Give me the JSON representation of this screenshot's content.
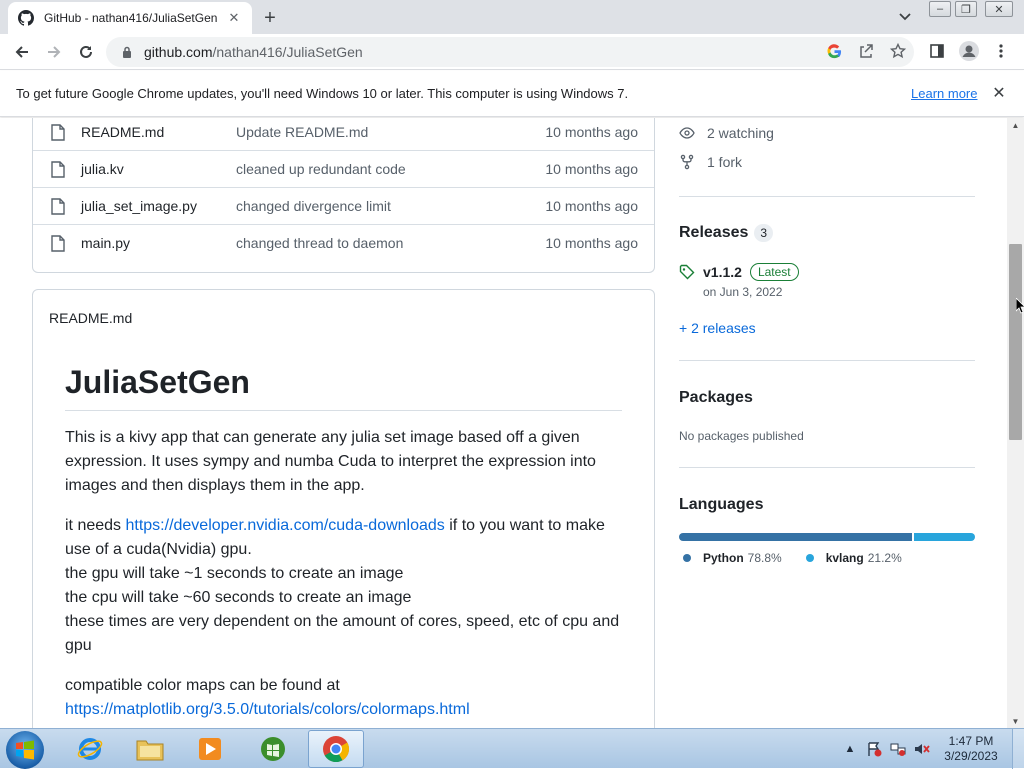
{
  "browser": {
    "tab_title": "GitHub - nathan416/JuliaSetGen",
    "url_host": "github.com",
    "url_path": "/nathan416/JuliaSetGen",
    "infobar_message": "To get future Google Chrome updates, you'll need Windows 10 or later. This computer is using Windows 7.",
    "infobar_link": "Learn more"
  },
  "files": [
    {
      "name": "README.md",
      "message": "Update README.md",
      "age": "10 months ago"
    },
    {
      "name": "julia.kv",
      "message": "cleaned up redundant code",
      "age": "10 months ago"
    },
    {
      "name": "julia_set_image.py",
      "message": "changed divergence limit",
      "age": "10 months ago"
    },
    {
      "name": "main.py",
      "message": "changed thread to daemon",
      "age": "10 months ago"
    }
  ],
  "readme": {
    "header": "README.md",
    "title": "JuliaSetGen",
    "para1": "This is a kivy app that can generate any julia set image based off a given expression. It uses sympy and numba Cuda to interpret the expression into images and then displays them in the app.",
    "para2_prefix": "it needs ",
    "para2_link": "https://developer.nvidia.com/cuda-downloads",
    "para2_suffix": " if to you want to make use of a cuda(Nvidia) gpu.",
    "line_gpu": "the gpu will take ~1 seconds to create an image",
    "line_cpu": "the cpu will take ~60 seconds to create an image",
    "line_times": "these times are very dependent on the amount of cores, speed, etc of cpu and gpu",
    "para3": "compatible color maps can be found at",
    "para3_link": "https://matplotlib.org/3.5.0/tutorials/colors/colormaps.html"
  },
  "sidebar": {
    "watching": "2 watching",
    "forks": "1 fork",
    "releases_title": "Releases",
    "releases_count": "3",
    "release_version": "v1.1.2",
    "release_badge": "Latest",
    "release_date": "on Jun 3, 2022",
    "more_releases": "+ 2 releases",
    "packages_title": "Packages",
    "packages_text": "No packages published",
    "languages_title": "Languages",
    "languages": [
      {
        "name": "Python",
        "percent": "78.8%",
        "fraction": 0.788,
        "color": "#3572A5"
      },
      {
        "name": "kvlang",
        "percent": "21.2%",
        "fraction": 0.212,
        "color": "#28a5dc"
      }
    ]
  },
  "taskbar": {
    "time": "1:47 PM",
    "date": "3/29/2023",
    "apps": [
      "internet-explorer",
      "file-explorer",
      "media-player",
      "media-center",
      "chrome"
    ]
  }
}
